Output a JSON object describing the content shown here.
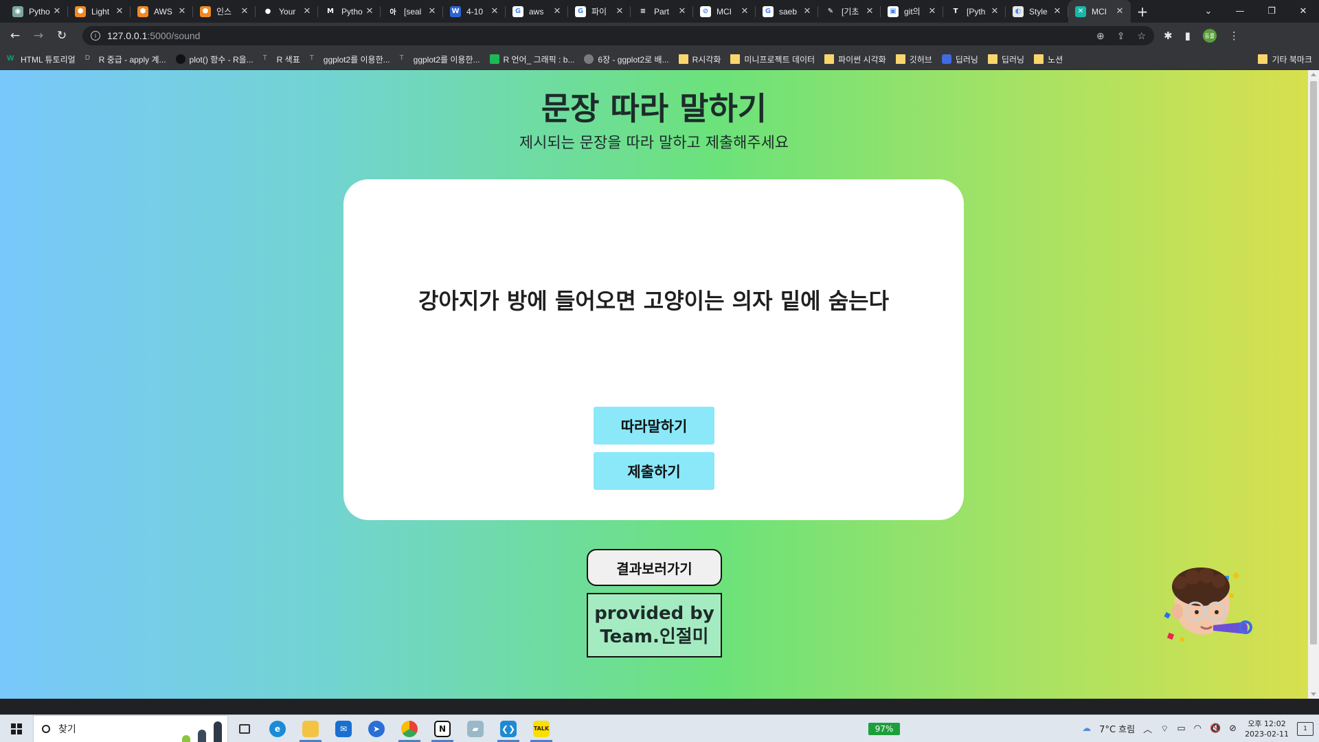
{
  "browser": {
    "tabs": [
      {
        "title": "Pytho",
        "color": "#7aa6a0",
        "glyph": "◉"
      },
      {
        "title": "Light",
        "color": "#f08a24",
        "glyph": "⬢"
      },
      {
        "title": "AWS",
        "color": "#f08a24",
        "glyph": "⬢"
      },
      {
        "title": "인스",
        "color": "#f08a24",
        "glyph": "⬢"
      },
      {
        "title": "Your",
        "color": "#202124",
        "glyph": "●"
      },
      {
        "title": "Pytho",
        "color": "#202124",
        "glyph": "M"
      },
      {
        "title": "[seal",
        "color": "#202124",
        "glyph": "아"
      },
      {
        "title": "4-10",
        "color": "#2b66d6",
        "glyph": "W"
      },
      {
        "title": "aws",
        "color": "#ffffff",
        "glyph": "G"
      },
      {
        "title": "파이",
        "color": "#ffffff",
        "glyph": "G"
      },
      {
        "title": "Part",
        "color": "#202124",
        "glyph": "≡"
      },
      {
        "title": "MCI",
        "color": "#ffffff",
        "glyph": "⊘"
      },
      {
        "title": "saeb",
        "color": "#ffffff",
        "glyph": "G"
      },
      {
        "title": "[기초",
        "color": "#202124",
        "glyph": "✎"
      },
      {
        "title": "git의",
        "color": "#ffffff",
        "glyph": "▣"
      },
      {
        "title": "[Pyth",
        "color": "#202124",
        "glyph": "T"
      },
      {
        "title": "Style",
        "color": "#e8e8e8",
        "glyph": "◐"
      },
      {
        "title": "MCI",
        "color": "#1bb6a8",
        "glyph": "✕",
        "active": true
      }
    ],
    "new_tab_glyph": "+",
    "url_host": "127.0.0.1",
    "url_path": ":5000/sound",
    "profile_initials": "동률",
    "bookmarks": [
      {
        "label": "HTML 튜토리얼",
        "icon": "w3",
        "glyph": "W"
      },
      {
        "label": "R 중급 - apply 계...",
        "icon": "tick",
        "glyph": "D"
      },
      {
        "label": "plot() 함수 - R을...",
        "icon": "dark",
        "glyph": ""
      },
      {
        "label": "R 색표",
        "icon": "tick",
        "glyph": "T"
      },
      {
        "label": "ggplot2를 이용한...",
        "icon": "tick",
        "glyph": "T"
      },
      {
        "label": "ggplot2를 이용한...",
        "icon": "tick",
        "glyph": "T"
      },
      {
        "label": "R 언어_ 그래픽 : b...",
        "icon": "green",
        "glyph": ""
      },
      {
        "label": "6장 - ggplot2로 배...",
        "icon": "gray",
        "glyph": ""
      },
      {
        "label": "R시각화",
        "icon": "folder",
        "glyph": ""
      },
      {
        "label": "미니프로젝트 데이터",
        "icon": "folder",
        "glyph": ""
      },
      {
        "label": "파이썬 시각화",
        "icon": "folder",
        "glyph": ""
      },
      {
        "label": "깃허브",
        "icon": "folder",
        "glyph": ""
      },
      {
        "label": "딥러닝",
        "icon": "blue",
        "glyph": ""
      },
      {
        "label": "딥러닝",
        "icon": "folder",
        "glyph": ""
      },
      {
        "label": "노션",
        "icon": "folder",
        "glyph": ""
      }
    ],
    "other_bookmarks": "기타 북마크"
  },
  "page": {
    "title": "문장 따라 말하기",
    "subtitle": "제시되는 문장을 따라 말하고 제출해주세요",
    "sentence": "강아지가 방에 들어오면 고양이는 의자 밑에 숨는다",
    "repeat_button": "따라말하기",
    "submit_button": "제출하기",
    "results_button": "결과보러가기",
    "credit_line1": "provided by",
    "credit_line2": "Team.인절미"
  },
  "taskbar": {
    "search_placeholder": "찾기",
    "battery": "97%",
    "weather": "7°C 흐림",
    "time": "오후 12:02",
    "date": "2023-02-11",
    "notifications": "1"
  }
}
